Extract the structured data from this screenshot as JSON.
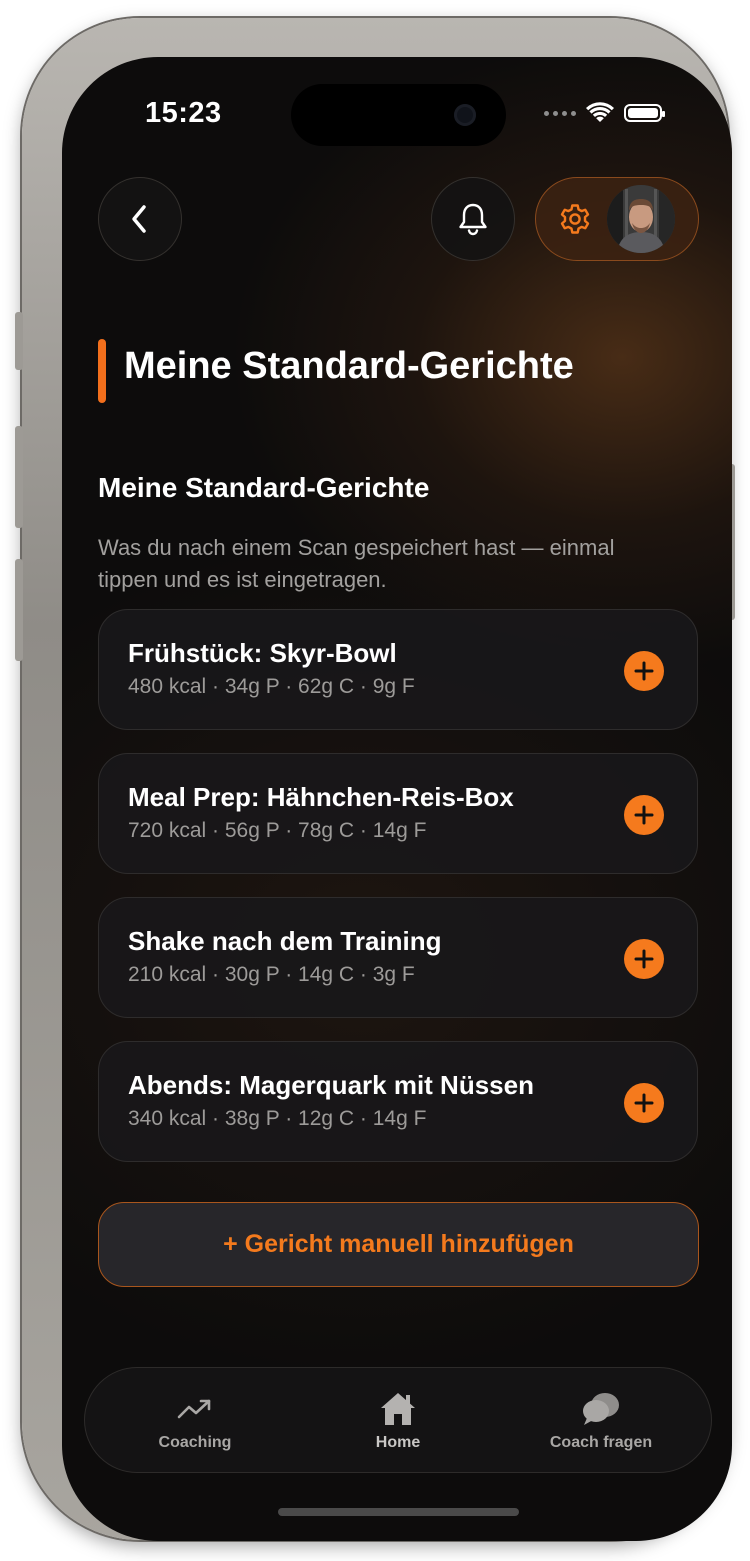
{
  "status_bar": {
    "time": "15:23"
  },
  "header": {
    "back_icon": "chevron-left-icon",
    "notification_icon": "bell-icon",
    "settings_icon": "gear-icon",
    "avatar_icon": "user-avatar"
  },
  "page": {
    "title": "Meine Standard-Gerichte"
  },
  "section": {
    "heading": "Meine Standard-Gerichte",
    "description": "Was du nach einem Scan gespeichert hast — einmal tippen und es ist eingetragen."
  },
  "meals": [
    {
      "name": "Frühstück: Skyr-Bowl",
      "macros": "480 kcal · 34g P · 62g C · 9g F"
    },
    {
      "name": "Meal Prep: Hähnchen-Reis-Box",
      "macros": "720 kcal · 56g P · 78g C · 14g F"
    },
    {
      "name": "Shake nach dem Training",
      "macros": "210 kcal · 30g P · 14g C · 3g F"
    },
    {
      "name": "Abends: Magerquark mit Nüssen",
      "macros": "340 kcal · 38g P · 12g C · 14g F"
    }
  ],
  "manual_add": {
    "label": "+ Gericht manuell hinzufügen"
  },
  "tabbar": {
    "items": [
      {
        "label": "Coaching",
        "icon": "trending-up-icon"
      },
      {
        "label": "Home",
        "icon": "home-icon"
      },
      {
        "label": "Coach fragen",
        "icon": "chat-bubbles-icon"
      }
    ]
  },
  "colors": {
    "accent": "#f57a1d",
    "background": "#0d0c0c",
    "card": "#181719",
    "muted_text": "#a2a09e"
  }
}
